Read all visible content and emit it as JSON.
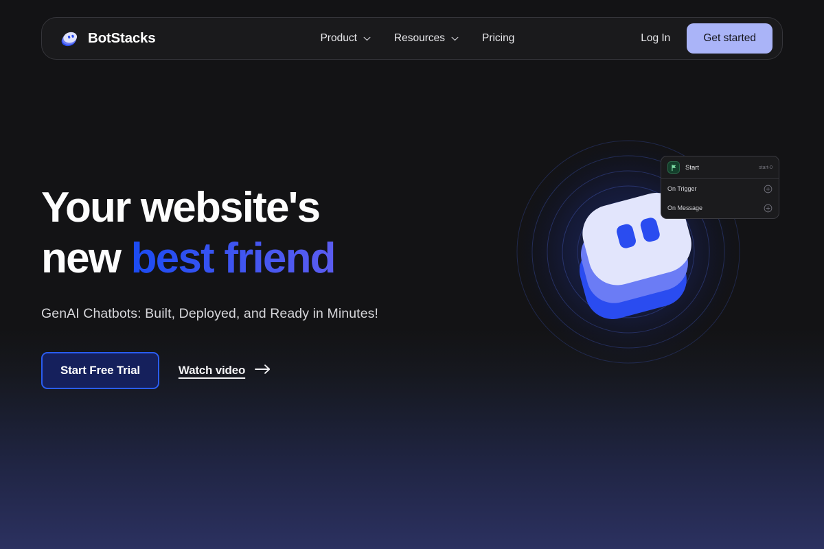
{
  "nav": {
    "brand": {
      "name": "BotStacks",
      "logo_icon": "botstacks-mascot-icon"
    },
    "links": [
      {
        "label": "Product",
        "has_dropdown": true,
        "icon": "chevron-down-icon"
      },
      {
        "label": "Resources",
        "has_dropdown": true,
        "icon": "chevron-down-icon"
      },
      {
        "label": "Pricing",
        "has_dropdown": false
      }
    ],
    "login_label": "Log In",
    "get_started_label": "Get started"
  },
  "hero": {
    "headline_line1": "Your website's",
    "headline_line2_plain": "new ",
    "headline_line2_gradient": "best friend",
    "subheadline": "GenAI Chatbots: Built, Deployed, and Ready in Minutes!",
    "primary_cta": "Start Free Trial",
    "secondary_cta": "Watch video",
    "secondary_cta_icon": "arrow-right-icon"
  },
  "flow_panel": {
    "node_icon": "green-flag-icon",
    "node_title": "Start",
    "node_id": "start-0",
    "rows": [
      {
        "label": "On Trigger",
        "icon": "plus-circle-icon"
      },
      {
        "label": "On Message",
        "icon": "plus-circle-icon"
      }
    ]
  },
  "colors": {
    "page_background": "#131315",
    "page_background_bottom": "#2b3160",
    "nav_background": "#1a1a1c",
    "nav_border": "#35353a",
    "accent_button": "#aab4f8",
    "gradient_start": "#1b4bf2",
    "gradient_end": "#5b5cf0",
    "trial_border": "#2a5cf0",
    "trial_fill": "#15205c",
    "flag_green": "#2a6a4a"
  }
}
